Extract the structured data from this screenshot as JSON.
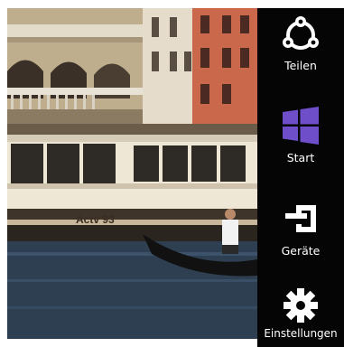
{
  "charms": {
    "share_label": "Teilen",
    "start_label": "Start",
    "devices_label": "Geräte",
    "settings_label": "Einstellungen"
  },
  "photo": {
    "boat_text": "Actv 93"
  },
  "colors": {
    "charms_background": "#050505",
    "start_icon": "#6e4fc9",
    "icon_foreground": "#ffffff"
  }
}
